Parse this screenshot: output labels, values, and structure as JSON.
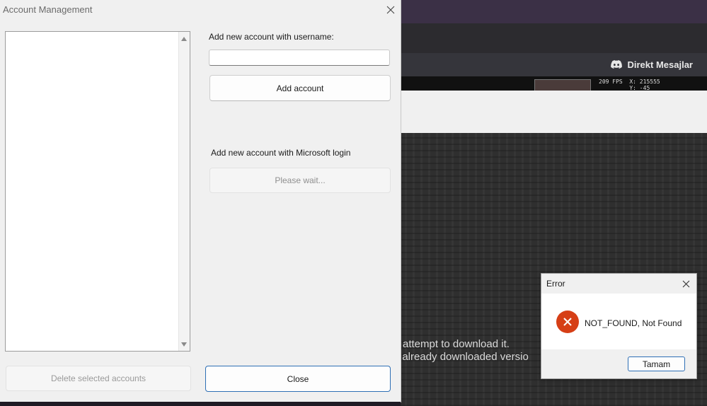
{
  "background": {
    "discord_label": "Direkt Mesajlar",
    "fps_text": "209 FPS",
    "coords_text": "X: 215555\nY: -45",
    "launcher_message_line1": "attempt to download it.",
    "launcher_message_line2": "t already downloaded versio"
  },
  "account_dialog": {
    "title": "Account Management",
    "username_label": "Add new account with username:",
    "username_value": "",
    "add_account_label": "Add account",
    "microsoft_label": "Add new account with Microsoft login",
    "microsoft_button_label": "Please wait...",
    "delete_label": "Delete selected accounts",
    "close_label": "Close",
    "accounts": []
  },
  "error_dialog": {
    "title": "Error",
    "message": "NOT_FOUND, Not Found",
    "ok_label": "Tamam"
  },
  "colors": {
    "error_icon": "#d63f16",
    "accent_border": "#2e6fb5"
  }
}
